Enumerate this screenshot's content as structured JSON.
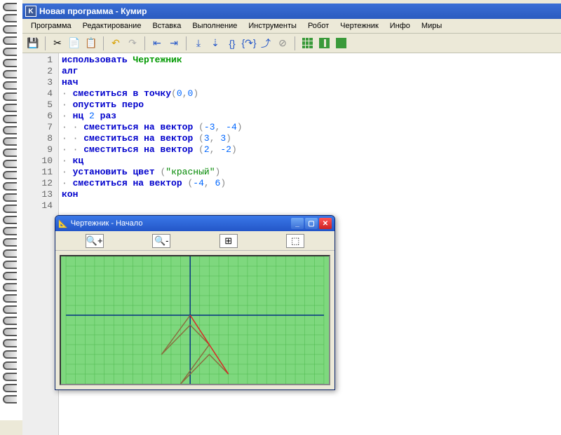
{
  "app_title": "Новая программа - Кумир",
  "app_icon_letter": "K",
  "menu": [
    "Программа",
    "Редактирование",
    "Вставка",
    "Выполнение",
    "Инструменты",
    "Робот",
    "Чертежник",
    "Инфо",
    "Миры"
  ],
  "code_lines": [
    {
      "n": "1",
      "html": "<span class='kw'>использовать</span> <span class='mod'>Чертежник</span>"
    },
    {
      "n": "2",
      "html": "<span class='kw'>алг</span>"
    },
    {
      "n": "3",
      "html": "<span class='kw'>нач</span>"
    },
    {
      "n": "4",
      "html": "<span class='dot'>·</span> <span class='kw'>сместиться в точку</span><span class='pn'>(</span><span class='num'>0</span><span class='pn'>,</span><span class='num'>0</span><span class='pn'>)</span>"
    },
    {
      "n": "5",
      "html": "<span class='dot'>·</span> <span class='kw'>опустить перо</span>"
    },
    {
      "n": "6",
      "html": "<span class='dot'>·</span> <span class='kw'>нц</span> <span class='num'>2</span> <span class='kw'>раз</span>"
    },
    {
      "n": "7",
      "html": "<span class='dot'>·</span> <span class='dot'>·</span> <span class='kw'>сместиться на вектор</span> <span class='pn'>(</span><span class='num'>-3</span><span class='pn'>,</span> <span class='num'>-4</span><span class='pn'>)</span>"
    },
    {
      "n": "8",
      "html": "<span class='dot'>·</span> <span class='dot'>·</span> <span class='kw'>сместиться на вектор</span> <span class='pn'>(</span><span class='num'>3</span><span class='pn'>,</span> <span class='num'>3</span><span class='pn'>)</span>"
    },
    {
      "n": "9",
      "html": "<span class='dot'>·</span> <span class='dot'>·</span> <span class='kw'>сместиться на вектор</span> <span class='pn'>(</span><span class='num'>2</span><span class='pn'>,</span> <span class='num'>-2</span><span class='pn'>)</span>"
    },
    {
      "n": "10",
      "html": "<span class='dot'>·</span> <span class='kw'>кц</span>"
    },
    {
      "n": "11",
      "html": "<span class='dot'>·</span> <span class='kw'>установить цвет</span> <span class='pn'>(</span><span class='str'>\"красный\"</span><span class='pn'>)</span>"
    },
    {
      "n": "12",
      "html": "<span class='dot'>·</span> <span class='kw'>сместиться на вектор</span> <span class='pn'>(</span><span class='num'>-4</span><span class='pn'>,</span> <span class='num'>6</span><span class='pn'>)</span>"
    },
    {
      "n": "13",
      "html": "<span class='kw'>кон</span>"
    },
    {
      "n": "14",
      "html": ""
    }
  ],
  "drawer_title": "Чертежник - Начало",
  "chart_data": {
    "type": "line",
    "title": "Чертежник",
    "xlim": [
      -13,
      14
    ],
    "ylim": [
      -7,
      6
    ],
    "grid": true,
    "series": [
      {
        "name": "path",
        "color": "#8b6a3e",
        "points": [
          [
            0,
            0
          ],
          [
            -3,
            -4
          ],
          [
            0,
            -1
          ],
          [
            2,
            -3
          ],
          [
            -1,
            -7
          ],
          [
            2,
            -4
          ],
          [
            4,
            -6
          ]
        ]
      },
      {
        "name": "red",
        "color": "#dd2222",
        "points": [
          [
            4,
            -6
          ],
          [
            0,
            0
          ]
        ]
      }
    ]
  }
}
